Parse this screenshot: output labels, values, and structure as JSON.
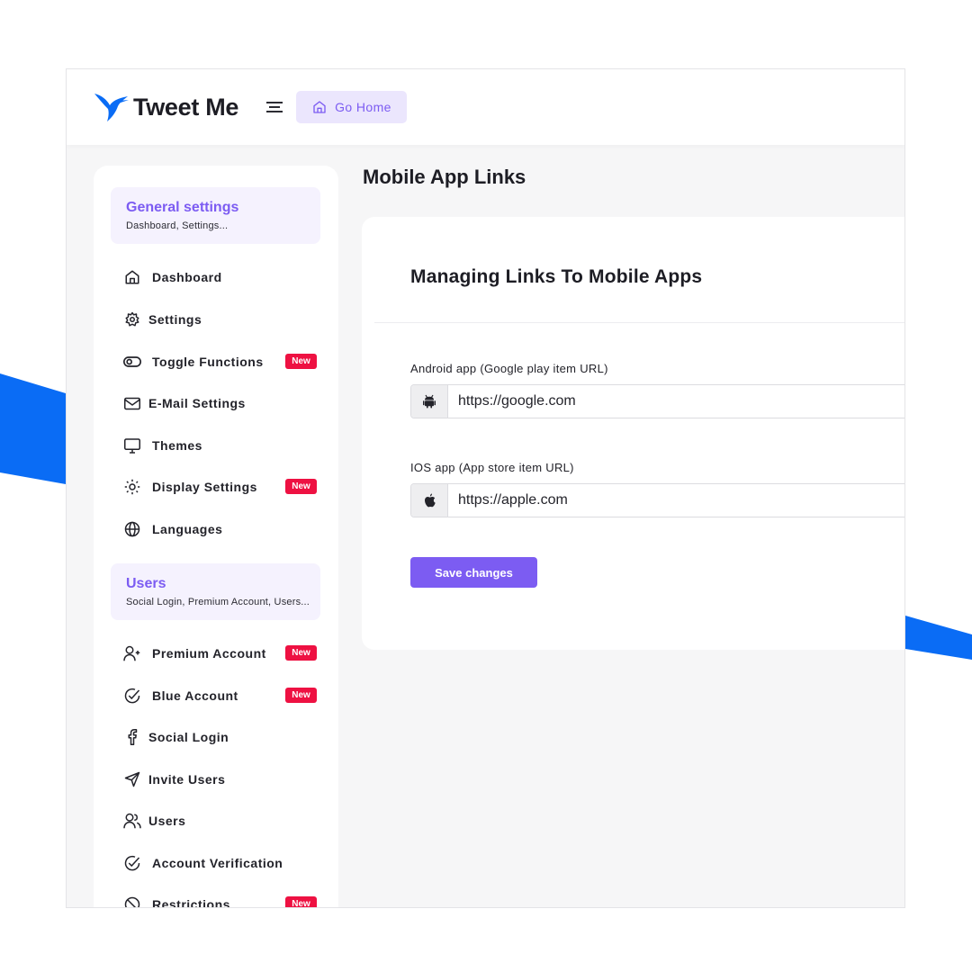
{
  "app": {
    "name": "Tweet Me",
    "logo_icon": "hummingbird-logo-icon",
    "accent_color": "#7c5cf2",
    "brand_blue": "#0a6cf5"
  },
  "topbar": {
    "menu_icon": "menu-lines-icon",
    "home_button": {
      "label": "Go Home",
      "icon": "home-icon"
    }
  },
  "sidebar": {
    "sections": [
      {
        "title": "General settings",
        "subtitle": "Dashboard, Settings...",
        "items": [
          {
            "label": "Dashboard",
            "icon": "home-icon",
            "badge": ""
          },
          {
            "label": "Settings",
            "icon": "gear-icon",
            "badge": ""
          },
          {
            "label": "Toggle Functions",
            "icon": "toggle-icon",
            "badge": "New"
          },
          {
            "label": "E-Mail Settings",
            "icon": "mail-icon",
            "badge": ""
          },
          {
            "label": "Themes",
            "icon": "monitor-icon",
            "badge": ""
          },
          {
            "label": "Display Settings",
            "icon": "sun-icon",
            "badge": "New"
          },
          {
            "label": "Languages",
            "icon": "globe-icon",
            "badge": ""
          }
        ]
      },
      {
        "title": "Users",
        "subtitle": "Social Login, Premium Account, Users...",
        "items": [
          {
            "label": "Premium Account",
            "icon": "user-plus-icon",
            "badge": "New"
          },
          {
            "label": "Blue Account",
            "icon": "check-circle-icon",
            "badge": "New"
          },
          {
            "label": "Social Login",
            "icon": "facebook-icon",
            "badge": ""
          },
          {
            "label": "Invite Users",
            "icon": "send-icon",
            "badge": ""
          },
          {
            "label": "Users",
            "icon": "users-icon",
            "badge": ""
          },
          {
            "label": "Account Verification",
            "icon": "check-circle-icon",
            "badge": ""
          },
          {
            "label": "Restrictions",
            "icon": "ban-icon",
            "badge": "New"
          }
        ]
      }
    ]
  },
  "main": {
    "page_title": "Mobile App Links",
    "card": {
      "title": "Managing Links To Mobile Apps",
      "fields": [
        {
          "label": "Android app (Google play item URL)",
          "icon": "android-icon",
          "value": "https://google.com"
        },
        {
          "label": "IOS app (App store item URL)",
          "icon": "apple-icon",
          "value": "https://apple.com"
        }
      ],
      "save_label": "Save changes"
    }
  }
}
